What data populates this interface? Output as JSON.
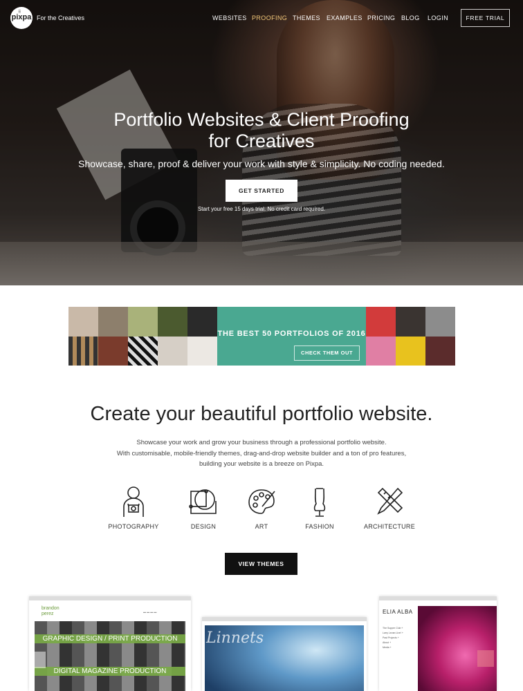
{
  "nav": {
    "logo_text": "pixpa",
    "tagline": "For the Creatives",
    "items": [
      "WEBSITES",
      "PROOFING",
      "THEMES",
      "EXAMPLES",
      "PRICING",
      "BLOG",
      "LOGIN"
    ],
    "active_item": "PROOFING",
    "trial_label": "FREE TRIAL"
  },
  "hero": {
    "title_line1": "Portfolio Websites & Client Proofing",
    "title_line2": "for Creatives",
    "subtitle": "Showcase, share, proof & deliver your work with style & simplicity. No coding needed.",
    "cta_label": "GET STARTED",
    "note": "Start your free 15 days trial. No credit card required."
  },
  "banner": {
    "title": "THE BEST 50 PORTFOLIOS OF 2016",
    "cta_label": "CHECK THEM OUT",
    "accent_color": "#4aa891"
  },
  "section": {
    "title": "Create your beautiful portfolio website.",
    "desc_line1": "Showcase your work and grow your business through a professional portfolio website.",
    "desc_line2": "With customisable, mobile-friendly themes, drag-and-drop website builder and a ton of pro features,",
    "desc_line3": "building your website is a breeze on Pixpa.",
    "categories": [
      {
        "label": "PHOTOGRAPHY",
        "icon": "photographer-icon"
      },
      {
        "label": "DESIGN",
        "icon": "design-icon"
      },
      {
        "label": "ART",
        "icon": "palette-icon"
      },
      {
        "label": "FASHION",
        "icon": "mannequin-icon"
      },
      {
        "label": "ARCHITECTURE",
        "icon": "ruler-pencil-icon"
      }
    ],
    "cta_label": "VIEW THEMES"
  },
  "previews": {
    "p1": {
      "logo_line1": "brandon",
      "logo_line2": "perez",
      "band1": "GRAPHIC DESIGN / PRINT PRODUCTION",
      "band2": "DIGITAL MAGAZINE PRODUCTION"
    },
    "p2": {
      "script_text": "Linnets"
    },
    "p3": {
      "title": "ELIA ALBA",
      "menu": [
        "The Supper Club +",
        "Larry Levan Live! +",
        "Past Projects +",
        "About +",
        "Media +"
      ]
    }
  }
}
